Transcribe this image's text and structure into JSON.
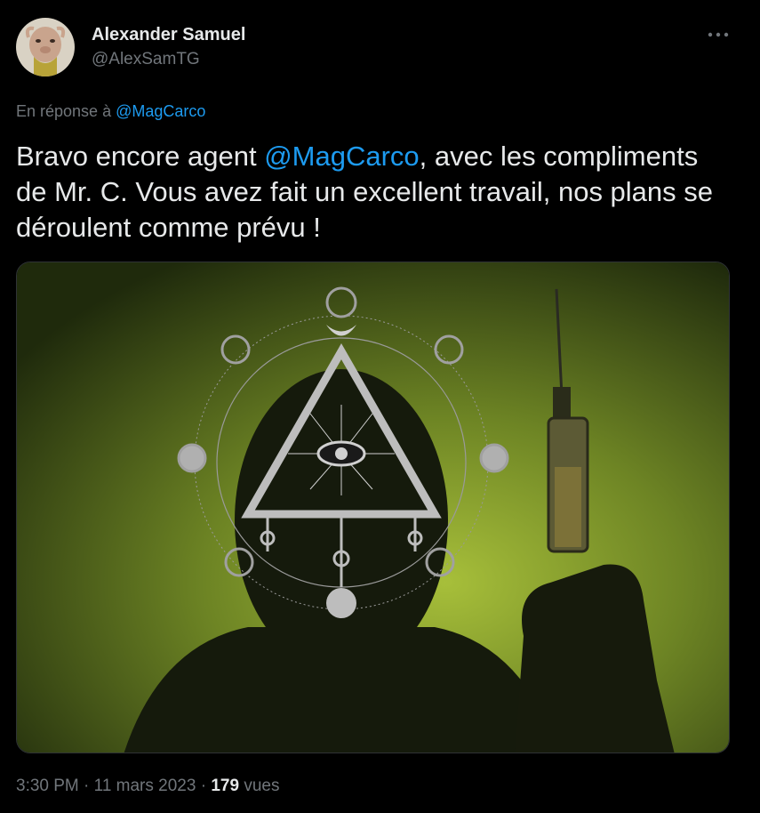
{
  "author": {
    "name": "Alexander Samuel",
    "handle": "@AlexSamTG",
    "avatar_icon": "avatar-image"
  },
  "header": {
    "more_icon": "more-horizontal-icon"
  },
  "reply": {
    "prefix": "En réponse à",
    "mention": "@MagCarco"
  },
  "tweet": {
    "text_before": "Bravo encore agent ",
    "mention": "@MagCarco",
    "text_after": ", avec les compliments de Mr. C. Vous avez fait un excellent travail, nos plans se déroulent comme prévu !"
  },
  "media": {
    "icon": "illuminati-syringe-image"
  },
  "footer": {
    "time": "3:30 PM",
    "separator": "·",
    "date": "11 mars 2023",
    "views_count": "179",
    "views_label": "vues"
  },
  "colors": {
    "background": "#000000",
    "text": "#e7e9ea",
    "muted": "#71767b",
    "link": "#1d9bf0"
  }
}
